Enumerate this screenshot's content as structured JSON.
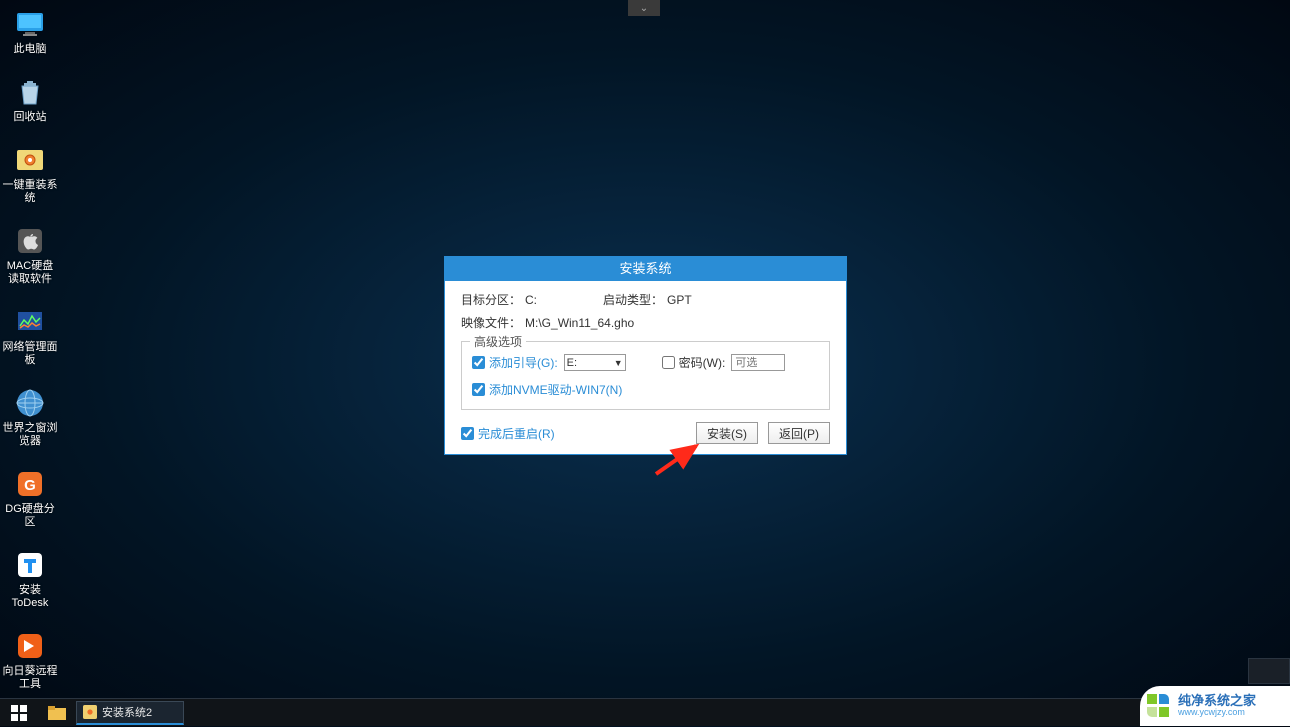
{
  "top_chevron": "⌄",
  "desktop": {
    "items": [
      {
        "label": "此电脑",
        "icon": "pc"
      },
      {
        "label": "回收站",
        "icon": "recycle"
      },
      {
        "label": "一键重装系统",
        "icon": "gear"
      },
      {
        "label": "MAC硬盘读取软件",
        "icon": "apple"
      },
      {
        "label": "网络管理面板",
        "icon": "net"
      },
      {
        "label": "世界之窗浏览器",
        "icon": "browser"
      },
      {
        "label": "DG硬盘分区",
        "icon": "dg"
      },
      {
        "label": "安装ToDesk",
        "icon": "todesk"
      },
      {
        "label": "向日葵远程工具",
        "icon": "sunflower"
      }
    ]
  },
  "dialog": {
    "title": "安装系统",
    "target_partition_label": "目标分区：",
    "target_partition_value": "C:",
    "boot_type_label": "启动类型：",
    "boot_type_value": "GPT",
    "image_file_label": "映像文件：",
    "image_file_value": "M:\\G_Win11_64.gho",
    "advanced_legend": "高级选项",
    "add_boot": {
      "checked": true,
      "label": "添加引导(G):",
      "value": "E:"
    },
    "password": {
      "checked": false,
      "label": "密码(W):",
      "placeholder": "可选"
    },
    "add_nvme": {
      "checked": true,
      "label": "添加NVME驱动-WIN7(N)"
    },
    "reboot_after": {
      "checked": true,
      "label": "完成后重启(R)"
    },
    "install_btn": "安装(S)",
    "back_btn": "返回(P)"
  },
  "taskbar": {
    "task_label": "安装系统2"
  },
  "watermark": {
    "title": "纯净系统之家",
    "url": "www.ycwjzy.com"
  }
}
